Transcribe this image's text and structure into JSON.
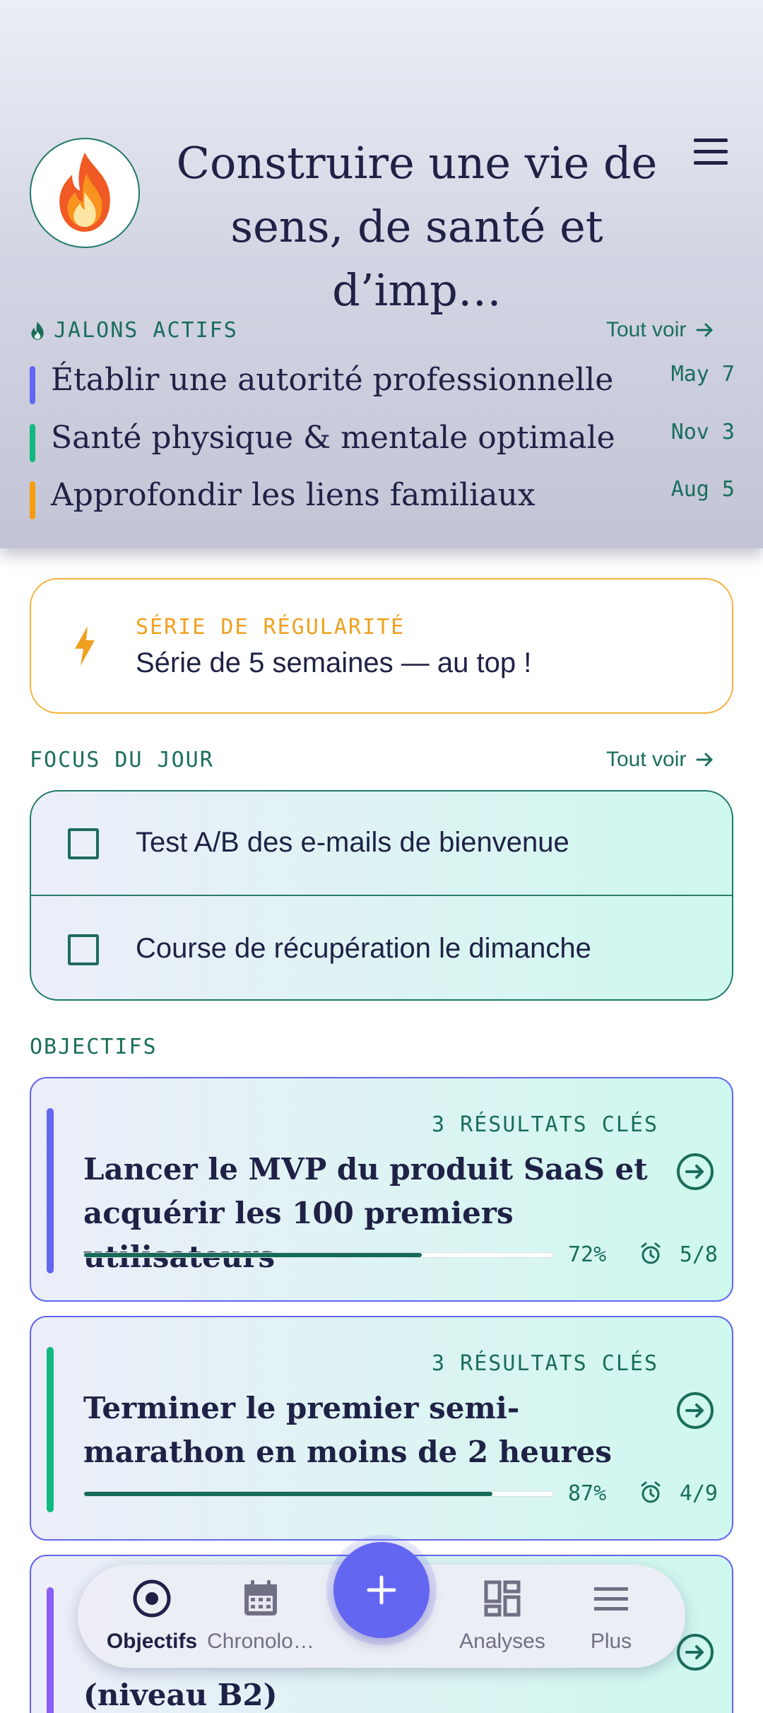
{
  "header": {
    "title": "Construire une vie de sens, de santé et d’imp…",
    "avatar_icon": "fire-emoji-icon",
    "menu_icon": "hamburger-menu-icon"
  },
  "milestones": {
    "label": "JALONS ACTIFS",
    "see_all": "Tout voir",
    "items": [
      {
        "name": "Établir une autorité professionnelle",
        "date": "May 7",
        "color": "#6366f1"
      },
      {
        "name": "Santé physique & mentale optimale",
        "date": "Nov 3",
        "color": "#10b981"
      },
      {
        "name": "Approfondir les liens familiaux",
        "date": "Aug 5",
        "color": "#f59e0b"
      }
    ]
  },
  "streak": {
    "label": "SÉRIE DE RÉGULARITÉ",
    "text": "Série de 5 semaines — au top !",
    "icon": "lightning-bolt-icon",
    "color": "#f0a020"
  },
  "focus": {
    "label": "FOCUS DU JOUR",
    "see_all": "Tout voir",
    "tasks": [
      {
        "label": "Test A/B des e-mails de bienvenue",
        "checked": false
      },
      {
        "label": "Course de récupération le dimanche",
        "checked": false
      }
    ]
  },
  "goals": {
    "label": "OBJECTIFS",
    "items": [
      {
        "key_results": "3 RÉSULTATS CLÉS",
        "title": "Lancer le MVP du produit SaaS et acquérir les 100 premiers utilisateurs",
        "progress": 72,
        "progress_label": "72%",
        "count": "5/8",
        "color": "#6366f1"
      },
      {
        "key_results": "3 RÉSULTATS CLÉS",
        "title": "Terminer le premier semi-marathon en moins de 2 heures",
        "progress": 87,
        "progress_label": "87%",
        "count": "4/9",
        "color": "#10b981"
      },
      {
        "title": "(niveau B2)",
        "color": "#8b5cf6"
      }
    ]
  },
  "nav": {
    "items": [
      {
        "label": "Objectifs",
        "icon": "target-icon",
        "active": true
      },
      {
        "label": "Chronolo…",
        "icon": "calendar-icon",
        "active": false
      },
      {
        "label": "Analyses",
        "icon": "dashboard-icon",
        "active": false
      },
      {
        "label": "Plus",
        "icon": "menu-icon",
        "active": false
      }
    ],
    "fab_label": "+"
  },
  "colors": {
    "accent": "#6366f1",
    "teal": "#1a6d5c",
    "ink": "#1f2146"
  }
}
